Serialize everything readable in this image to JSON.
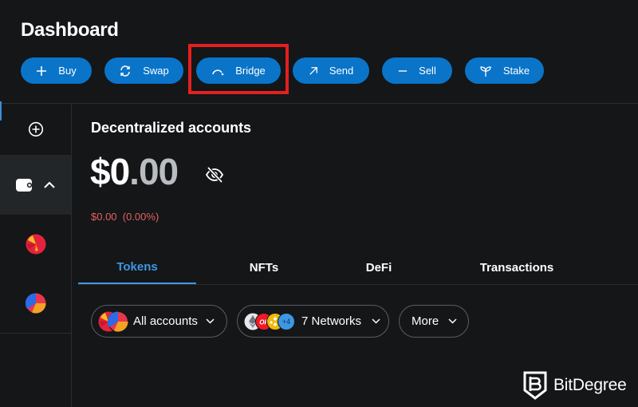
{
  "header": {
    "title": "Dashboard"
  },
  "actions": [
    {
      "label": "Buy",
      "icon": "plus-icon"
    },
    {
      "label": "Swap",
      "icon": "swap-icon"
    },
    {
      "label": "Bridge",
      "icon": "bridge-icon",
      "highlighted": true
    },
    {
      "label": "Send",
      "icon": "arrow-up-right-icon"
    },
    {
      "label": "Sell",
      "icon": "minus-icon"
    },
    {
      "label": "Stake",
      "icon": "sprout-icon"
    }
  ],
  "sidebar": {
    "add_icon": "plus-circle-icon",
    "wallet_icon": "wallet-icon",
    "expand_icon": "chevron-up-icon",
    "accounts": [
      {
        "name": "account-avatar-1"
      },
      {
        "name": "account-avatar-2"
      }
    ]
  },
  "main": {
    "section_title": "Decentralized accounts",
    "balance": {
      "whole": "$0",
      "dot": ".",
      "cents": "00"
    },
    "change": "$0.00  (0.00%)",
    "tabs": [
      {
        "label": "Tokens",
        "active": true
      },
      {
        "label": "NFTs",
        "active": false
      },
      {
        "label": "DeFi",
        "active": false
      },
      {
        "label": "Transactions",
        "active": false
      }
    ],
    "filters": {
      "accounts": "All accounts",
      "networks": "7 Networks",
      "networks_extra": "+4",
      "more": "More"
    }
  },
  "watermark": {
    "text": "BitDegree"
  },
  "colors": {
    "accent": "#0a74c9",
    "tab_active": "#3d97e3",
    "negative": "#e56161",
    "highlight": "#e41f1f",
    "background": "#141618"
  }
}
